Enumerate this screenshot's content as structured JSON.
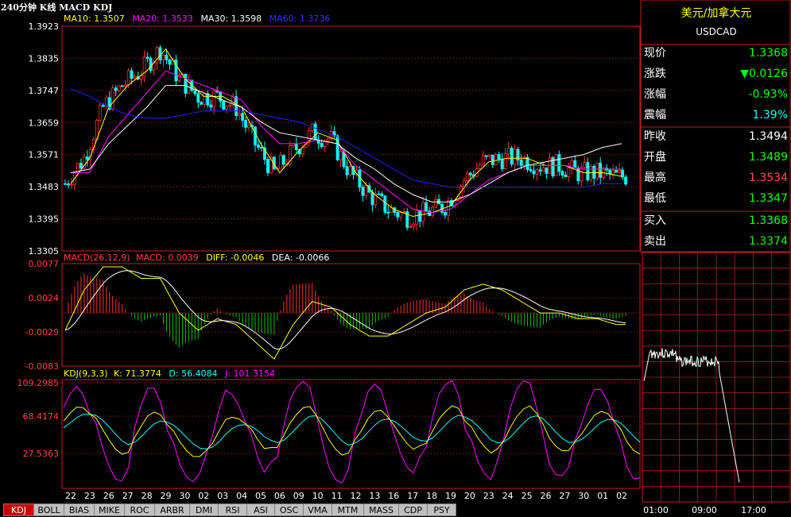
{
  "header": {
    "period_label": "240分钟 K线 MACD KDJ",
    "ma_legend": [
      {
        "label": "MA10: 1.3507",
        "color": "#ffff00"
      },
      {
        "label": "MA20: 1.3533",
        "color": "#ff00ff"
      },
      {
        "label": "MA30: 1.3598",
        "color": "#ffffff"
      },
      {
        "label": "MA60: 1.3736",
        "color": "#0000ff"
      }
    ]
  },
  "macd_legend": [
    {
      "label": "MACD(26,12,9)",
      "color": "#ff4040"
    },
    {
      "label": "MACD: 0.0039",
      "color": "#ff4040"
    },
    {
      "label": "DIFF: -0.0046",
      "color": "#ffff00"
    },
    {
      "label": "DEA: -0.0066",
      "color": "#ffffff"
    }
  ],
  "kdj_legend": [
    {
      "label": "KDJ(9,3,3)",
      "color": "#ffff00"
    },
    {
      "label": "K: 71.3774",
      "color": "#ffff00"
    },
    {
      "label": "D: 56.4084",
      "color": "#00ffff"
    },
    {
      "label": "J: 101.3154",
      "color": "#ff00ff"
    }
  ],
  "price_axis": [
    "1.3923",
    "1.3835",
    "1.3747",
    "1.3659",
    "1.3571",
    "1.3483",
    "1.3395",
    "1.3305"
  ],
  "macd_axis": [
    "0.0077",
    "0.0024",
    "-0.0029",
    "-0.0083"
  ],
  "kdj_axis": [
    "109.2985",
    "68.4174",
    "27.5363"
  ],
  "date_axis": [
    "22",
    "23",
    "26",
    "27",
    "28",
    "29",
    "30",
    "02",
    "03",
    "04",
    "05",
    "06",
    "09",
    "10",
    "11",
    "12",
    "13",
    "16",
    "17",
    "18",
    "19",
    "20",
    "23",
    "24",
    "25",
    "26",
    "27",
    "30",
    "01",
    "02"
  ],
  "tabs": [
    "KDJ",
    "BOLL",
    "BIAS",
    "MIKE",
    "ROC",
    "ARBR",
    "DMI",
    "RSI",
    "ASI",
    "OSC",
    "VMA",
    "MTM",
    "MASS",
    "CDP",
    "PSY"
  ],
  "quote": {
    "title": "美元/加拿大元",
    "symbol": "USDCAD",
    "rows": [
      {
        "label": "现价",
        "value": "1.3368",
        "color": "#00ff00"
      },
      {
        "label": "涨跌",
        "value": "▼0.0126",
        "color": "#00ff00"
      },
      {
        "label": "涨幅",
        "value": "-0.93%",
        "color": "#00ff00"
      },
      {
        "label": "震幅",
        "value": "1.39%",
        "color": "#00ffff"
      },
      {
        "label": "昨收",
        "value": "1.3494",
        "color": "#ffffff"
      },
      {
        "label": "开盘",
        "value": "1.3489",
        "color": "#00ff00"
      },
      {
        "label": "最高",
        "value": "1.3534",
        "color": "#ff5050"
      },
      {
        "label": "最低",
        "value": "1.3347",
        "color": "#00ff00"
      },
      {
        "label": "买入",
        "value": "1.3368",
        "color": "#00ff00"
      },
      {
        "label": "卖出",
        "value": "1.3374",
        "color": "#00ff00"
      }
    ]
  },
  "intraday_axis": [
    "01:00",
    "09:00",
    "17:00"
  ],
  "chart_data": {
    "type": "line",
    "title": "240分钟 K线 MACD KDJ",
    "x": [
      "22",
      "23",
      "26",
      "27",
      "28",
      "29",
      "30",
      "02",
      "03",
      "04",
      "05",
      "06",
      "09",
      "10",
      "11",
      "12",
      "13",
      "16",
      "17",
      "18",
      "19",
      "20",
      "23",
      "24",
      "25",
      "26",
      "27",
      "30",
      "01",
      "02"
    ],
    "series": [
      {
        "name": "MA10",
        "values": [
          1.349,
          1.356,
          1.37,
          1.376,
          1.38,
          1.386,
          1.378,
          1.373,
          1.373,
          1.37,
          1.36,
          1.352,
          1.358,
          1.363,
          1.361,
          1.352,
          1.346,
          1.342,
          1.34,
          1.341,
          1.343,
          1.35,
          1.355,
          1.356,
          1.356,
          1.354,
          1.354,
          1.352,
          1.352,
          1.351
        ]
      },
      {
        "name": "MA20",
        "values": [
          1.352,
          1.352,
          1.362,
          1.368,
          1.374,
          1.38,
          1.378,
          1.376,
          1.374,
          1.372,
          1.365,
          1.36,
          1.36,
          1.361,
          1.36,
          1.354,
          1.35,
          1.346,
          1.342,
          1.341,
          1.342,
          1.346,
          1.35,
          1.352,
          1.354,
          1.354,
          1.354,
          1.353,
          1.353,
          1.353
        ]
      },
      {
        "name": "MA30",
        "values": [
          1.352,
          1.353,
          1.36,
          1.365,
          1.37,
          1.376,
          1.376,
          1.374,
          1.372,
          1.37,
          1.366,
          1.363,
          1.362,
          1.361,
          1.36,
          1.356,
          1.353,
          1.349,
          1.346,
          1.344,
          1.344,
          1.346,
          1.349,
          1.352,
          1.354,
          1.355,
          1.356,
          1.357,
          1.359,
          1.36
        ]
      },
      {
        "name": "MA60",
        "values": [
          1.375,
          1.373,
          1.37,
          1.368,
          1.367,
          1.367,
          1.368,
          1.369,
          1.369,
          1.369,
          1.368,
          1.367,
          1.366,
          1.364,
          1.362,
          1.359,
          1.356,
          1.353,
          1.35,
          1.349,
          1.348,
          1.348,
          1.348,
          1.348,
          1.348,
          1.348,
          1.348,
          1.348,
          1.349,
          1.349
        ]
      }
    ],
    "ylim": [
      1.3305,
      1.3923
    ]
  }
}
